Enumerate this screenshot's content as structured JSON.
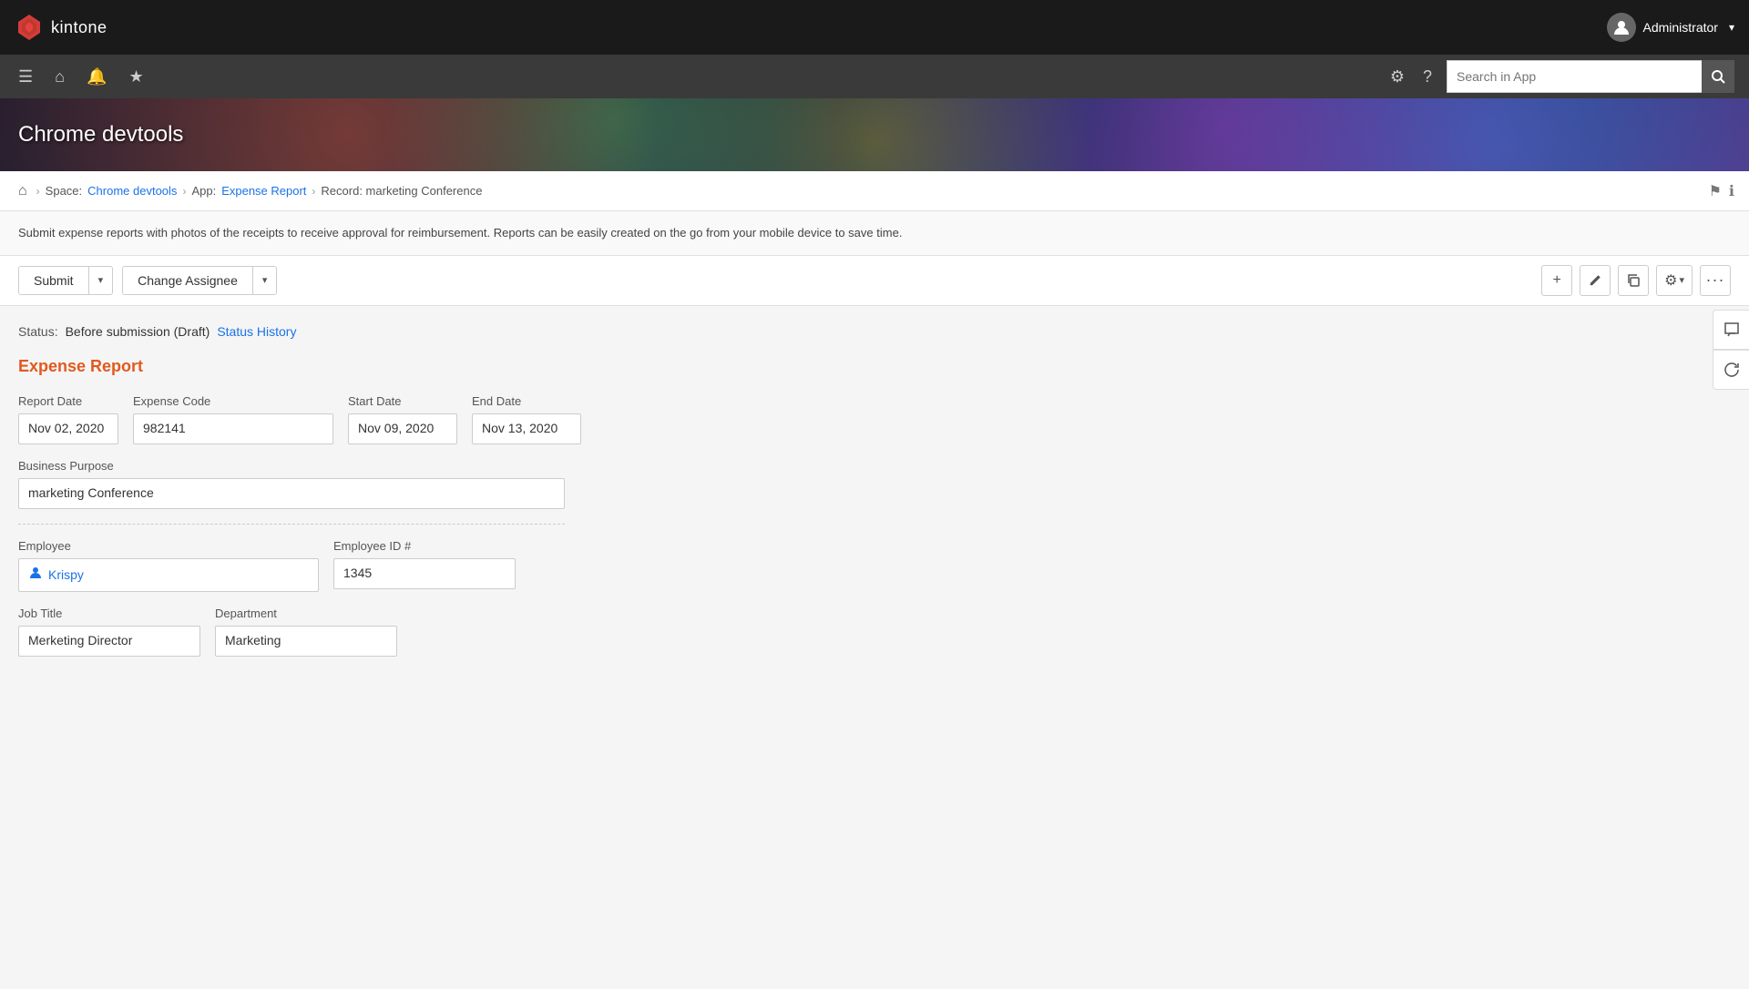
{
  "app": {
    "name": "kintone"
  },
  "topnav": {
    "logo_text": "kintone",
    "user_name": "Administrator",
    "chevron": "▾"
  },
  "secondarynav": {
    "search_placeholder": "Search in App",
    "search_btn_label": "🔍"
  },
  "banner": {
    "title": "Chrome devtools"
  },
  "breadcrumb": {
    "home": "⌂",
    "space_label": "Space:",
    "space_link": "Chrome devtools",
    "app_label": "App:",
    "app_link": "Expense Report",
    "record_label": "Record: marketing Conference"
  },
  "description": {
    "text": "Submit expense reports with photos of the receipts to receive approval for reimbursement. Reports can be easily created on the go from your mobile device to save time."
  },
  "actionbar": {
    "submit_label": "Submit",
    "change_assignee_label": "Change Assignee",
    "dropdown_arrow": "▾",
    "add_icon": "+",
    "edit_icon": "✎",
    "copy_icon": "⧉",
    "gear_icon": "⚙",
    "gear_arrow": "▾",
    "more_icon": "•••"
  },
  "status": {
    "label": "Status:",
    "value": "Before submission (Draft)",
    "history_link": "Status History"
  },
  "form": {
    "title": "Expense Report",
    "report_date_label": "Report Date",
    "report_date_value": "Nov 02, 2020",
    "expense_code_label": "Expense Code",
    "expense_code_value": "982141",
    "start_date_label": "Start Date",
    "start_date_value": "Nov 09, 2020",
    "end_date_label": "End Date",
    "end_date_value": "Nov 13, 2020",
    "business_purpose_label": "Business Purpose",
    "business_purpose_value": "marketing Conference",
    "employee_label": "Employee",
    "employee_value": "Krispy",
    "employee_id_label": "Employee ID #",
    "employee_id_value": "1345",
    "job_title_label": "Job Title",
    "job_title_value": "Merketing Director",
    "department_label": "Department",
    "department_value": "Marketing"
  },
  "rightpanel": {
    "chat_icon": "💬",
    "refresh_icon": "↻"
  }
}
